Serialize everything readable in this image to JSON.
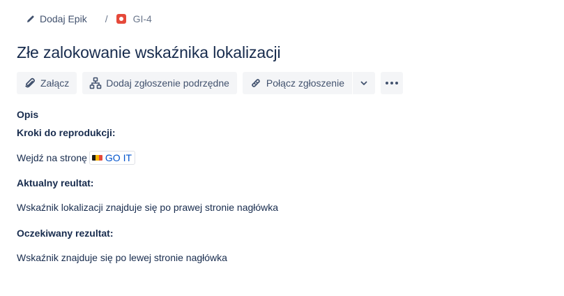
{
  "breadcrumb": {
    "epic_label": "Dodaj Epik",
    "separator": "/",
    "issue_key": "GI-4"
  },
  "issue": {
    "title": "Złe zalokowanie wskaźnika lokalizacji"
  },
  "toolbar": {
    "attach_label": "Załącz",
    "add_child_label": "Dodaj zgłoszenie podrzędne",
    "link_issue_label": "Połącz zgłoszenie"
  },
  "description": {
    "heading": "Opis",
    "steps_heading": "Kroki do reprodukcji:",
    "steps_text": "Wejdź na stronę",
    "link_label": "GO IT",
    "actual_heading": "Aktualny reultat:",
    "actual_text": "Wskaźnik lokalizacji znajduje się po prawej stronie nagłówka",
    "expected_heading": "Oczekiwany rezultat:",
    "expected_text": "Wskaźnik znajduje się po lewej stronie nagłówka"
  },
  "colors": {
    "bug_icon": "#e5493a",
    "link": "#0052cc",
    "button_bg": "#f4f5f7",
    "text": "#172b4d"
  },
  "icons": [
    "pencil-icon",
    "bug-icon",
    "paperclip-icon",
    "hierarchy-icon",
    "link-icon",
    "chevron-down-icon",
    "more-icon",
    "favicon-icon"
  ]
}
